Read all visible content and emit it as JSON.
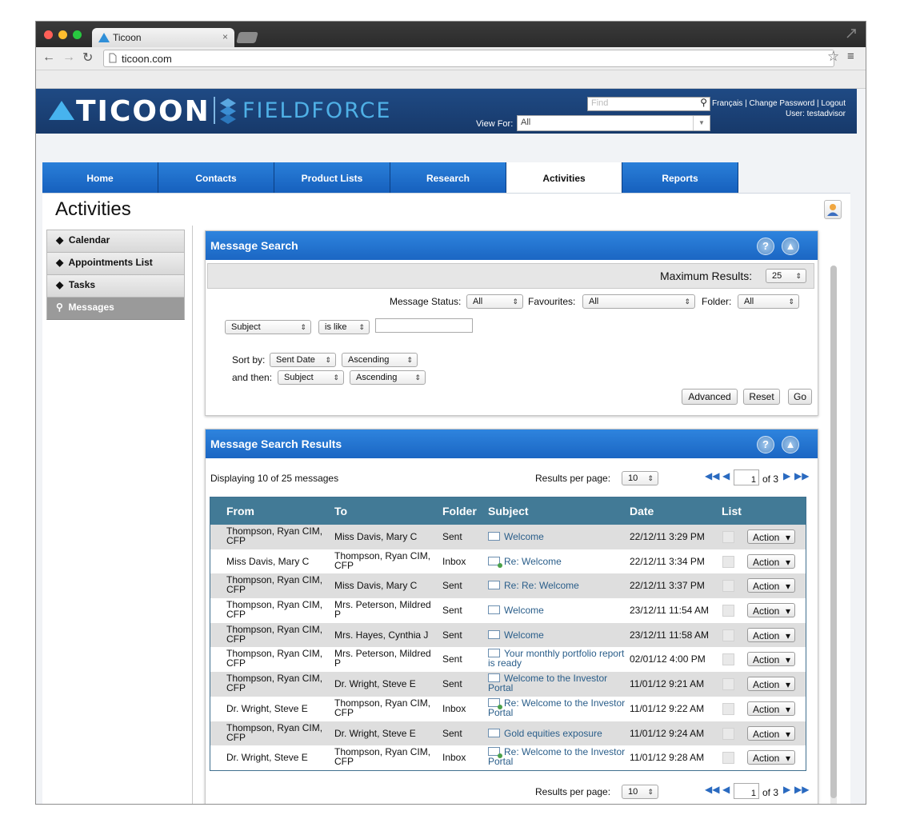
{
  "browser": {
    "tab_title": "Ticoon",
    "tab_close": "×",
    "url": "ticoon.com"
  },
  "header": {
    "logo_main": "TICOON",
    "logo_product": "FIELDFORCE",
    "find_placeholder": "Find",
    "links": "Français | Change Password | Logout",
    "user": "User: testadvisor",
    "view_for_label": "View For:",
    "view_for_value": "All"
  },
  "nav_tabs": [
    "Home",
    "Contacts",
    "Product Lists",
    "Research",
    "Activities",
    "Reports"
  ],
  "page_title": "Activities",
  "sidebar": [
    "Calendar",
    "Appointments List",
    "Tasks",
    "Messages"
  ],
  "search": {
    "title": "Message Search",
    "max_results_label": "Maximum Results:",
    "max_results_value": "25",
    "status_label": "Message Status:",
    "status_value": "All",
    "favourites_label": "Favourites:",
    "favourites_value": "All",
    "folder_label": "Folder:",
    "folder_value": "All",
    "field_value": "Subject",
    "operator_value": "is like",
    "sort_by_label": "Sort by:",
    "sort1_field": "Sent Date",
    "sort1_dir": "Ascending",
    "then_label": "and then:",
    "sort2_field": "Subject",
    "sort2_dir": "Ascending",
    "advanced_label": "Advanced",
    "reset_label": "Reset",
    "go_label": "Go"
  },
  "results": {
    "title": "Message Search Results",
    "displaying": "Displaying 10 of 25 messages",
    "per_page_label": "Results per page:",
    "per_page_value": "10",
    "page_value": "1",
    "of_pages": "of 3",
    "columns": [
      "From",
      "To",
      "Folder",
      "Subject",
      "Date",
      "List"
    ],
    "action_label": "Action",
    "rows": [
      {
        "from": "Thompson, Ryan CIM, CFP",
        "to": "Miss Davis, Mary C",
        "folder": "Sent",
        "subject": "Welcome",
        "date": "22/12/11 3:29 PM",
        "read": false
      },
      {
        "from": "Miss Davis, Mary C",
        "to": "Thompson, Ryan CIM, CFP",
        "folder": "Inbox",
        "subject": "Re: Welcome",
        "date": "22/12/11 3:34 PM",
        "read": true
      },
      {
        "from": "Thompson, Ryan CIM, CFP",
        "to": "Miss Davis, Mary C",
        "folder": "Sent",
        "subject": "Re: Re: Welcome",
        "date": "22/12/11 3:37 PM",
        "read": false
      },
      {
        "from": "Thompson, Ryan CIM, CFP",
        "to": "Mrs. Peterson, Mildred P",
        "folder": "Sent",
        "subject": "Welcome",
        "date": "23/12/11 11:54 AM",
        "read": false
      },
      {
        "from": "Thompson, Ryan CIM, CFP",
        "to": "Mrs. Hayes, Cynthia J",
        "folder": "Sent",
        "subject": "Welcome",
        "date": "23/12/11 11:58 AM",
        "read": false
      },
      {
        "from": "Thompson, Ryan CIM, CFP",
        "to": "Mrs. Peterson, Mildred P",
        "folder": "Sent",
        "subject": "Your monthly portfolio report is ready",
        "date": "02/01/12 4:00 PM",
        "read": false
      },
      {
        "from": "Thompson, Ryan CIM, CFP",
        "to": "Dr. Wright, Steve E",
        "folder": "Sent",
        "subject": "Welcome to the Investor Portal",
        "date": "11/01/12 9:21 AM",
        "read": false
      },
      {
        "from": "Dr. Wright, Steve E",
        "to": "Thompson, Ryan CIM, CFP",
        "folder": "Inbox",
        "subject": "Re: Welcome to the Investor Portal",
        "date": "11/01/12 9:22 AM",
        "read": true
      },
      {
        "from": "Thompson, Ryan CIM, CFP",
        "to": "Dr. Wright, Steve E",
        "folder": "Sent",
        "subject": "Gold equities exposure",
        "date": "11/01/12 9:24 AM",
        "read": false
      },
      {
        "from": "Dr. Wright, Steve E",
        "to": "Thompson, Ryan CIM, CFP",
        "folder": "Inbox",
        "subject": "Re: Welcome to the Investor Portal",
        "date": "11/01/12 9:28 AM",
        "read": true
      }
    ]
  },
  "colors": {
    "header_bg": "#1f4a84",
    "tab_blue": "#1f6fcf",
    "grid_header": "#427a96",
    "link": "#2a5e8a"
  }
}
